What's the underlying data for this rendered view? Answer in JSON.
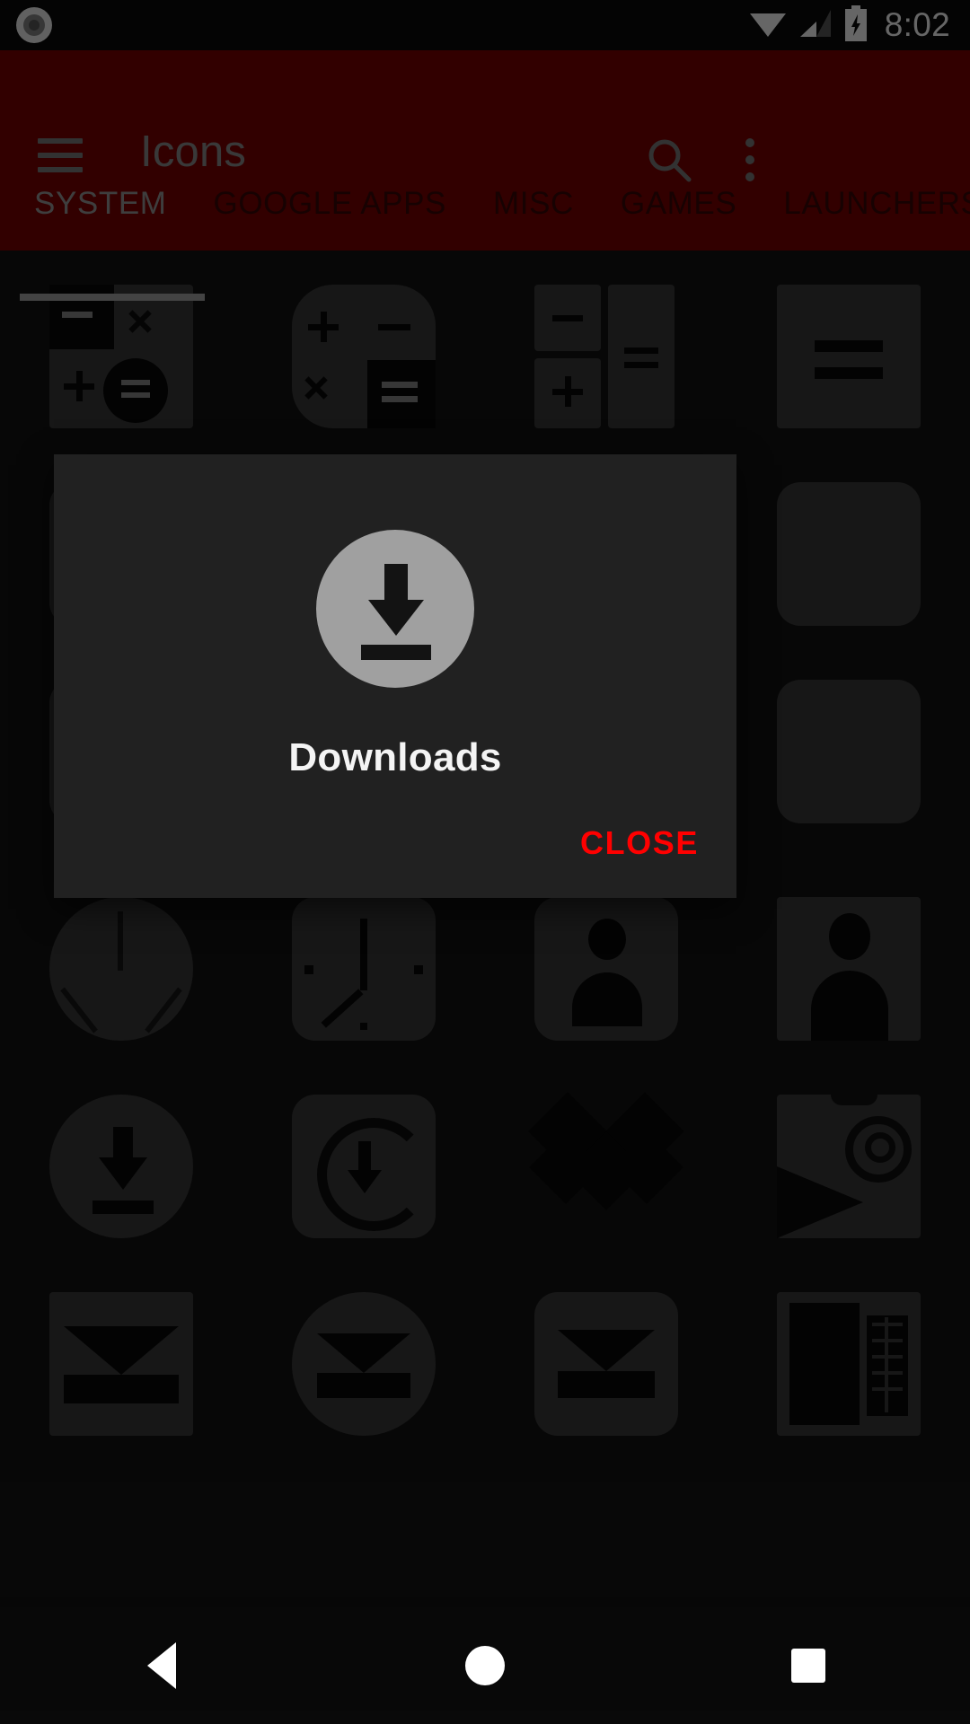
{
  "status_bar": {
    "time": "8:02",
    "icons": [
      "screen-record-indicator",
      "wifi-icon",
      "cell-signal-icon",
      "battery-charging-icon"
    ]
  },
  "app_bar": {
    "title": "Icons",
    "menu_icon": "hamburger-menu-icon",
    "search_icon": "search-icon",
    "overflow_icon": "overflow-menu-icon",
    "background_color": "#7E0000",
    "title_color": "#8F8F8F"
  },
  "tabs": {
    "active_index": 0,
    "items": [
      {
        "label": "SYSTEM"
      },
      {
        "label": "GOOGLE APPS"
      },
      {
        "label": "MISC"
      },
      {
        "label": "GAMES"
      },
      {
        "label": "LAUNCHERS"
      }
    ],
    "active_color": "#9B9B9B",
    "inactive_color": "#3A0505",
    "indicator_color": "#A8A8A8"
  },
  "dialog": {
    "icon": "download-icon",
    "title": "Downloads",
    "close_label": "CLOSE",
    "close_color": "#FF0000",
    "background_color": "#212121"
  },
  "nav_bar": {
    "back_icon": "back-triangle-icon",
    "home_icon": "home-circle-icon",
    "recents_icon": "recents-square-icon"
  },
  "icon_grid": {
    "rows": [
      {
        "cells": [
          {
            "name": "calculator-icon-a",
            "shape": "sq"
          },
          {
            "name": "calculator-icon-b",
            "shape": "sqr"
          },
          {
            "name": "calculator-icon-c",
            "shape": "sq"
          },
          {
            "name": "calculator-icon-d",
            "shape": "sq"
          }
        ]
      },
      {
        "cells": [
          {
            "name": "calendar-icon-a",
            "shape": "rsq"
          },
          {
            "name": "calendar-icon-b",
            "shape": "rsq"
          },
          {
            "name": "calendar-icon-c",
            "shape": "rsq"
          },
          {
            "name": "calendar-icon-d",
            "shape": "rsq"
          }
        ]
      },
      {
        "cells": [
          {
            "name": "camera-icon-a",
            "shape": "rsq"
          },
          {
            "name": "camera-icon-b",
            "shape": "rsq"
          },
          {
            "name": "camera-icon-c",
            "shape": "rsq"
          },
          {
            "name": "camera-icon-d",
            "shape": "rsq"
          }
        ]
      },
      {
        "cells": [
          {
            "name": "clock-icon-a",
            "shape": "circ"
          },
          {
            "name": "clock-icon-b",
            "shape": "rsq"
          },
          {
            "name": "contacts-icon-a",
            "shape": "rsq"
          },
          {
            "name": "contacts-icon-b",
            "shape": "sq"
          }
        ]
      },
      {
        "cells": [
          {
            "name": "downloads-icon",
            "shape": "circ"
          },
          {
            "name": "downloader-icon",
            "shape": "rsq"
          },
          {
            "name": "dropbox-icon",
            "shape": "none"
          },
          {
            "name": "email-at-icon",
            "shape": "sq"
          }
        ]
      },
      {
        "cells": [
          {
            "name": "email-icon-a",
            "shape": "sq"
          },
          {
            "name": "email-icon-b",
            "shape": "circ"
          },
          {
            "name": "email-icon-c",
            "shape": "rsq"
          },
          {
            "name": "excel-icon",
            "shape": "sq"
          }
        ]
      }
    ]
  }
}
